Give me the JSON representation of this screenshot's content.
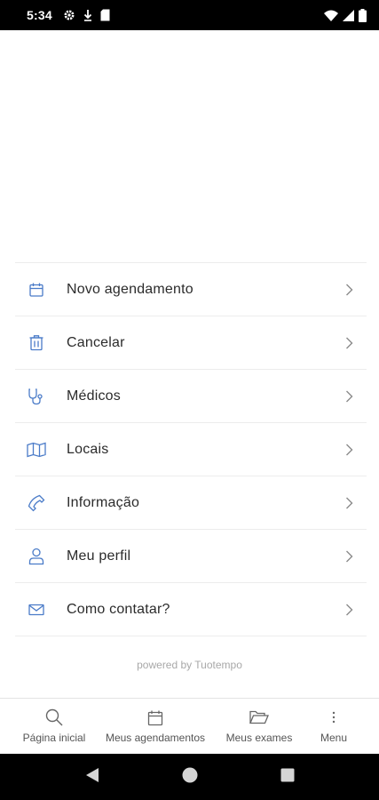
{
  "status_bar": {
    "time": "5:34",
    "left_icons": [
      "settings-icon",
      "download-icon",
      "sim-card-icon"
    ],
    "right_icons": [
      "wifi-icon",
      "signal-icon",
      "battery-icon"
    ]
  },
  "menu": {
    "accent_color": "#4a7bc8",
    "items": [
      {
        "label": "Novo agendamento",
        "icon": "calendar-icon"
      },
      {
        "label": "Cancelar",
        "icon": "trash-icon"
      },
      {
        "label": "Médicos",
        "icon": "stethoscope-icon"
      },
      {
        "label": "Locais",
        "icon": "map-icon"
      },
      {
        "label": "Informação",
        "icon": "phone-icon"
      },
      {
        "label": "Meu perfil",
        "icon": "user-icon"
      },
      {
        "label": "Como contatar?",
        "icon": "mail-icon"
      }
    ]
  },
  "footer": {
    "powered_by": "powered by Tuotempo"
  },
  "bottom_nav": {
    "items": [
      {
        "label": "Página inicial",
        "icon": "search-icon"
      },
      {
        "label": "Meus agendamentos",
        "icon": "calendar-icon"
      },
      {
        "label": "Meus exames",
        "icon": "folder-icon"
      },
      {
        "label": "Menu",
        "icon": "more-vertical-icon"
      }
    ]
  },
  "android_nav": [
    "back-icon",
    "home-icon",
    "recents-icon"
  ]
}
